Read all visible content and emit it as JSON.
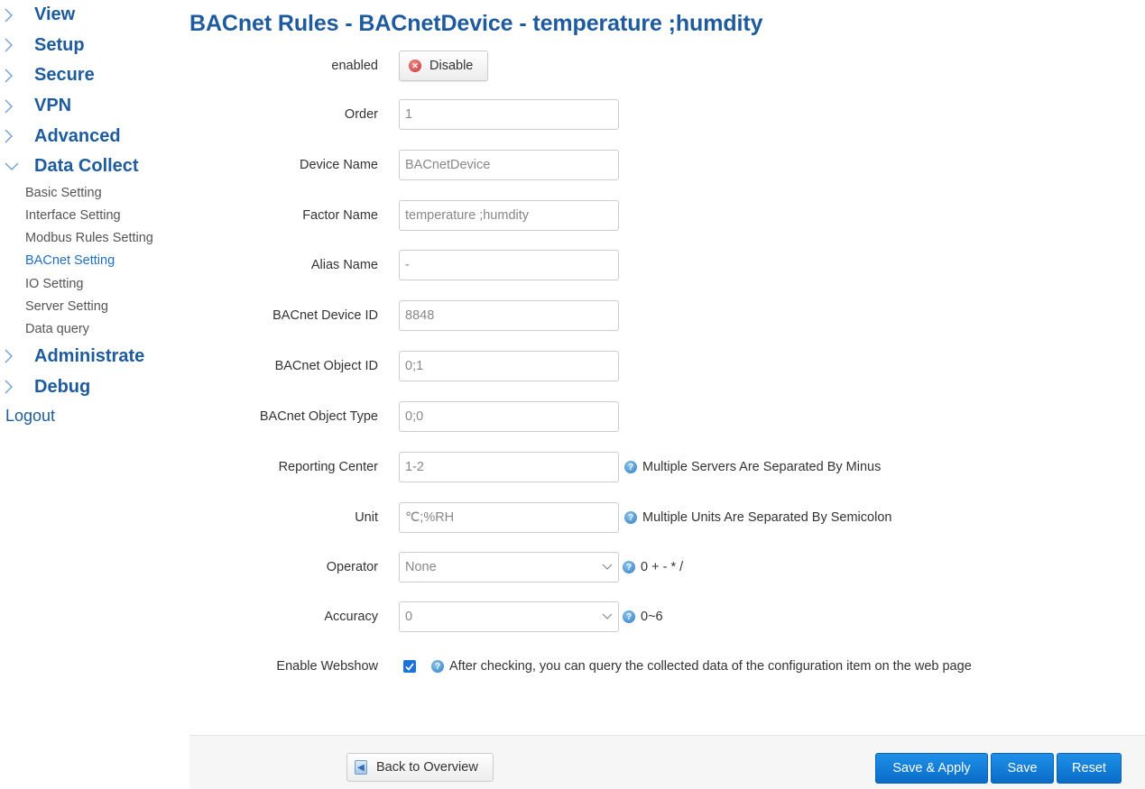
{
  "sidebar": {
    "top_items": [
      {
        "label": "View",
        "icon": "chevron-right-icon"
      },
      {
        "label": "Setup",
        "icon": "chevron-right-icon"
      },
      {
        "label": "Secure",
        "icon": "chevron-right-icon"
      },
      {
        "label": "VPN",
        "icon": "chevron-right-icon"
      },
      {
        "label": "Advanced",
        "icon": "chevron-right-icon"
      },
      {
        "label": "Data Collect",
        "icon": "chevron-down-icon",
        "expanded": true
      }
    ],
    "sub_items": [
      {
        "label": "Basic Setting",
        "active": false
      },
      {
        "label": "Interface Setting",
        "active": false
      },
      {
        "label": "Modbus Rules Setting",
        "active": false
      },
      {
        "label": "BACnet Setting",
        "active": true
      },
      {
        "label": "IO Setting",
        "active": false
      },
      {
        "label": "Server Setting",
        "active": false
      },
      {
        "label": "Data query",
        "active": false
      }
    ],
    "bottom_items": [
      {
        "label": "Administrate",
        "icon": "chevron-right-icon"
      },
      {
        "label": "Debug",
        "icon": "chevron-right-icon"
      }
    ],
    "logout": "Logout"
  },
  "page": {
    "title": "BACnet Rules - BACnetDevice - temperature ;humdity"
  },
  "form": {
    "enabled": {
      "label": "enabled",
      "button": "Disable"
    },
    "order": {
      "label": "Order",
      "value": "1"
    },
    "device_name": {
      "label": "Device Name",
      "value": "BACnetDevice"
    },
    "factor_name": {
      "label": "Factor Name",
      "value": "temperature ;humdity"
    },
    "alias_name": {
      "label": "Alias Name",
      "value": "-"
    },
    "device_id": {
      "label": "BACnet Device ID",
      "value": "8848"
    },
    "object_id": {
      "label": "BACnet Object ID",
      "value": "0;1"
    },
    "object_type": {
      "label": "BACnet Object Type",
      "value": "0;0"
    },
    "reporting_center": {
      "label": "Reporting Center",
      "value": "1-2",
      "help": "Multiple Servers Are Separated By Minus"
    },
    "unit": {
      "label": "Unit",
      "value": "℃;%RH",
      "help": "Multiple Units Are Separated By Semicolon"
    },
    "operator": {
      "label": "Operator",
      "selected": "None",
      "help": "0 + - * /"
    },
    "accuracy": {
      "label": "Accuracy",
      "selected": "0",
      "help": "0~6"
    },
    "webshow": {
      "label": "Enable Webshow",
      "checked": true,
      "help": "After checking, you can query the collected data of the configuration item on the web page"
    }
  },
  "footer": {
    "back": "Back to Overview",
    "save_apply": "Save & Apply",
    "save": "Save",
    "reset": "Reset"
  },
  "colors": {
    "accent": "#1e5b9e",
    "primary_button": "#0a7ad6",
    "active_link": "#1f6fc4"
  }
}
